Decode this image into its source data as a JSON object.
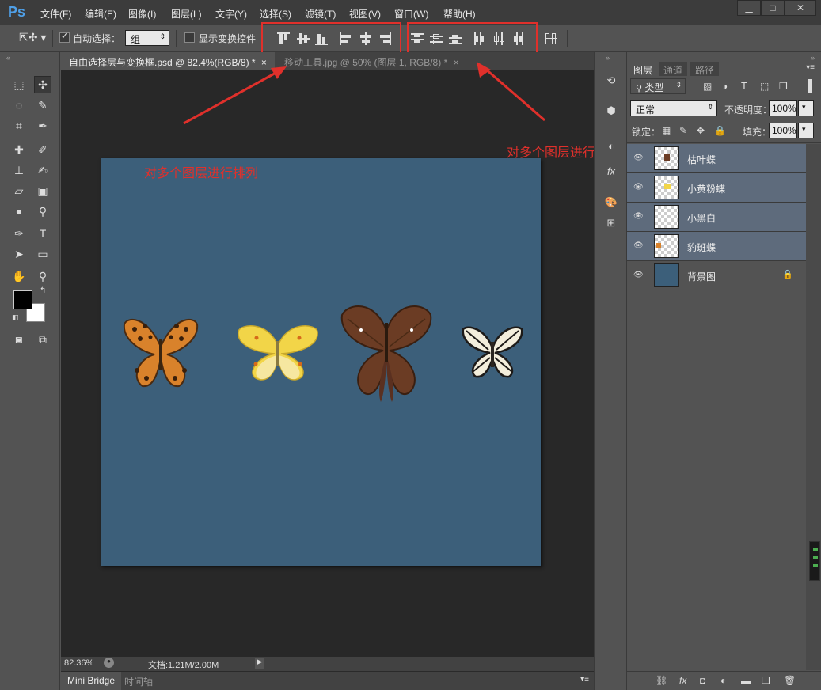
{
  "app": {
    "logo": "Ps"
  },
  "menu": [
    "文件(F)",
    "编辑(E)",
    "图像(I)",
    "图层(L)",
    "文字(Y)",
    "选择(S)",
    "滤镜(T)",
    "视图(V)",
    "窗口(W)",
    "帮助(H)"
  ],
  "window_buttons": {
    "minimize": "▁",
    "maximize": "□",
    "close": "✕"
  },
  "options": {
    "auto_select_label": "自动选择：",
    "auto_select_value": "组",
    "show_transform_label": "显示变换控件"
  },
  "tabs": [
    {
      "label": "自由选择层与变换框.psd @ 82.4%(RGB/8) *",
      "close": "×"
    },
    {
      "label": "移动工具.jpg @ 50% (图层 1, RGB/8) *",
      "close": "×"
    }
  ],
  "annotations": {
    "arrange": "对多个图层进行排列",
    "distribute": "对多个图层进行分布"
  },
  "status": {
    "zoom": "82.36%",
    "doc": "文档:1.21M/2.00M"
  },
  "bottom_tabs": [
    "Mini Bridge",
    "时间轴"
  ],
  "panel": {
    "tabs": [
      "图层",
      "通道",
      "路径"
    ],
    "filter_type": "类型",
    "blend_mode": "正常",
    "opacity_label": "不透明度：",
    "opacity_value": "100%",
    "lock_label": "锁定：",
    "fill_label": "填充：",
    "fill_value": "100%"
  },
  "layers": [
    {
      "name": "枯叶蝶"
    },
    {
      "name": "小黄粉蝶"
    },
    {
      "name": "小黑白"
    },
    {
      "name": "豹斑蝶"
    },
    {
      "name": "背景图"
    }
  ],
  "colors": {
    "canvas": "#3c5f7a",
    "annotation": "#e0302b",
    "selected_layer": "#5e6b7c"
  }
}
